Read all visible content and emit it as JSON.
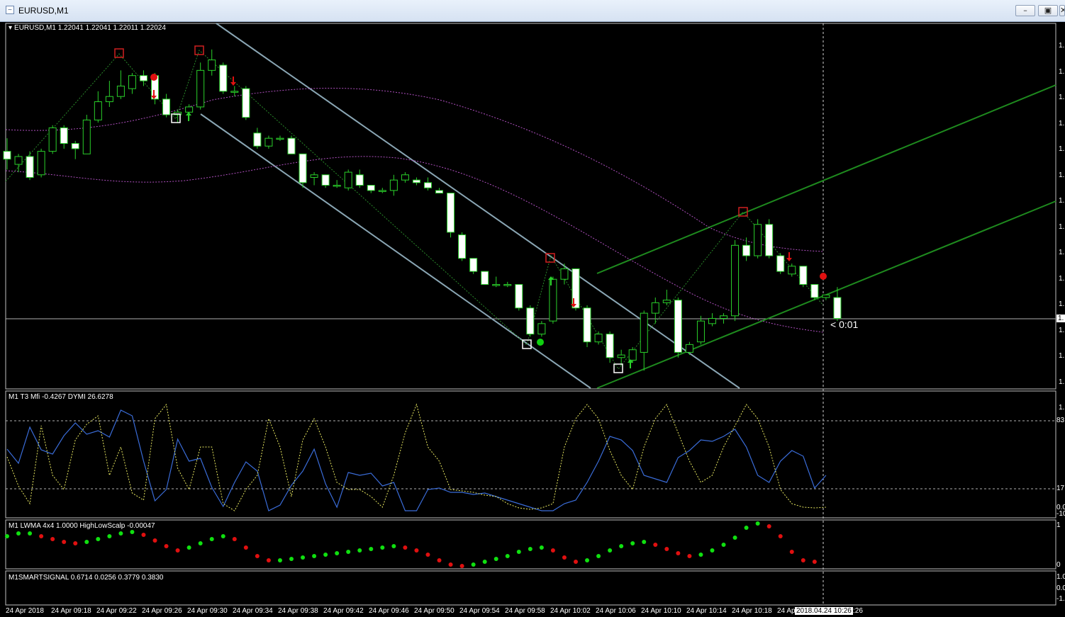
{
  "window": {
    "title": "EURUSD,M1",
    "minimize_icon": "minimize-icon",
    "restore_icon": "restore-icon",
    "close_icon": "close-icon"
  },
  "main_panel": {
    "header": "EURUSD,M1  1.22041 1.22041 1.22011 1.22024",
    "timer_label": "< 0:01",
    "price_axis_ticks": [
      "1.",
      "1.",
      "1.",
      "1.",
      "1.",
      "1.",
      "1.",
      "1.",
      "1.",
      "1.",
      "1.",
      "1.",
      "1.",
      "1.",
      "1."
    ],
    "current_price_label": "1."
  },
  "indicator1": {
    "header": "M1  T3 Mfi  -0.4267  DYMI 26.6278",
    "axis_labels": [
      "83",
      "17",
      "0.0",
      "-10"
    ]
  },
  "indicator2": {
    "header": "M1 LWMA 4x4  1.0000  HighLowScalp -0.00047",
    "axis_labels": [
      "1",
      "0"
    ]
  },
  "indicator3": {
    "header": "M1SMARTSIGNAL 0.6714 0.0256 0.3779 0.3830",
    "axis_labels": [
      "1.0",
      "0.0",
      "-1."
    ]
  },
  "time_axis": {
    "labels": [
      "24 Apr 2018",
      "24 Apr 09:18",
      "24 Apr 09:22",
      "24 Apr 09:26",
      "24 Apr 09:30",
      "24 Apr 09:34",
      "24 Apr 09:38",
      "24 Apr 09:42",
      "24 Apr 09:46",
      "24 Apr 09:50",
      "24 Apr 09:54",
      "24 Apr 09:58",
      "24 Apr 10:02",
      "24 Apr 10:06",
      "24 Apr 10:10",
      "24 Apr 10:14",
      "24 Apr 10:18",
      "24 Ap"
    ],
    "cursor_label": "2018.04.24 10:26",
    "cursor_tail": ":26"
  },
  "chart_data": {
    "type": "candlestick",
    "symbol": "EURUSD",
    "timeframe": "M1",
    "last_bar": {
      "open": 1.22041,
      "high": 1.22041,
      "low": 1.22011,
      "close": 1.22024
    },
    "candles": [
      {
        "o": 1.2231,
        "h": 1.2236,
        "l": 1.2224,
        "c": 1.2228
      },
      {
        "o": 1.2226,
        "h": 1.223,
        "l": 1.2223,
        "c": 1.2229
      },
      {
        "o": 1.2229,
        "h": 1.2231,
        "l": 1.222,
        "c": 1.2221
      },
      {
        "o": 1.2222,
        "h": 1.2232,
        "l": 1.2221,
        "c": 1.2231
      },
      {
        "o": 1.2231,
        "h": 1.2241,
        "l": 1.223,
        "c": 1.224
      },
      {
        "o": 1.224,
        "h": 1.2241,
        "l": 1.2232,
        "c": 1.2234
      },
      {
        "o": 1.2234,
        "h": 1.2235,
        "l": 1.2228,
        "c": 1.2232
      },
      {
        "o": 1.223,
        "h": 1.2245,
        "l": 1.223,
        "c": 1.2243
      },
      {
        "o": 1.2243,
        "h": 1.2254,
        "l": 1.2242,
        "c": 1.225
      },
      {
        "o": 1.225,
        "h": 1.2258,
        "l": 1.2248,
        "c": 1.2252
      },
      {
        "o": 1.2252,
        "h": 1.2262,
        "l": 1.2251,
        "c": 1.2256
      },
      {
        "o": 1.2255,
        "h": 1.2261,
        "l": 1.2253,
        "c": 1.226
      },
      {
        "o": 1.226,
        "h": 1.2262,
        "l": 1.2256,
        "c": 1.2258
      },
      {
        "o": 1.226,
        "h": 1.2261,
        "l": 1.2249,
        "c": 1.2251
      },
      {
        "o": 1.2251,
        "h": 1.2253,
        "l": 1.2244,
        "c": 1.2245
      },
      {
        "o": 1.2245,
        "h": 1.2247,
        "l": 1.2242,
        "c": 1.2246
      },
      {
        "o": 1.2246,
        "h": 1.2249,
        "l": 1.2243,
        "c": 1.2248
      },
      {
        "o": 1.2248,
        "h": 1.2265,
        "l": 1.2247,
        "c": 1.2262
      },
      {
        "o": 1.2262,
        "h": 1.227,
        "l": 1.226,
        "c": 1.2266
      },
      {
        "o": 1.2264,
        "h": 1.2265,
        "l": 1.2253,
        "c": 1.2254
      },
      {
        "o": 1.2254,
        "h": 1.2256,
        "l": 1.2252,
        "c": 1.2254
      },
      {
        "o": 1.2255,
        "h": 1.2256,
        "l": 1.2243,
        "c": 1.2244
      },
      {
        "o": 1.2238,
        "h": 1.224,
        "l": 1.2232,
        "c": 1.2233
      },
      {
        "o": 1.2233,
        "h": 1.2237,
        "l": 1.2232,
        "c": 1.2236
      },
      {
        "o": 1.2236,
        "h": 1.2237,
        "l": 1.2235,
        "c": 1.2236
      },
      {
        "o": 1.2236,
        "h": 1.2237,
        "l": 1.223,
        "c": 1.223
      },
      {
        "o": 1.223,
        "h": 1.223,
        "l": 1.2217,
        "c": 1.2219
      },
      {
        "o": 1.2221,
        "h": 1.2223,
        "l": 1.2218,
        "c": 1.2222
      },
      {
        "o": 1.2222,
        "h": 1.2222,
        "l": 1.2217,
        "c": 1.2218
      },
      {
        "o": 1.2218,
        "h": 1.222,
        "l": 1.2217,
        "c": 1.2218
      },
      {
        "o": 1.2217,
        "h": 1.2224,
        "l": 1.2216,
        "c": 1.2223
      },
      {
        "o": 1.2222,
        "h": 1.2224,
        "l": 1.2217,
        "c": 1.2218
      },
      {
        "o": 1.2218,
        "h": 1.2218,
        "l": 1.2215,
        "c": 1.2216
      },
      {
        "o": 1.2216,
        "h": 1.2217,
        "l": 1.2215,
        "c": 1.2216
      },
      {
        "o": 1.2216,
        "h": 1.2222,
        "l": 1.2214,
        "c": 1.222
      },
      {
        "o": 1.222,
        "h": 1.2223,
        "l": 1.2219,
        "c": 1.2222
      },
      {
        "o": 1.222,
        "h": 1.2221,
        "l": 1.2218,
        "c": 1.2219
      },
      {
        "o": 1.2219,
        "h": 1.2221,
        "l": 1.2216,
        "c": 1.2217
      },
      {
        "o": 1.2216,
        "h": 1.2217,
        "l": 1.2215,
        "c": 1.2215
      },
      {
        "o": 1.2215,
        "h": 1.2215,
        "l": 1.2198,
        "c": 1.22
      },
      {
        "o": 1.2199,
        "h": 1.22,
        "l": 1.2189,
        "c": 1.219
      },
      {
        "o": 1.219,
        "h": 1.219,
        "l": 1.2184,
        "c": 1.2185
      },
      {
        "o": 1.2185,
        "h": 1.2185,
        "l": 1.218,
        "c": 1.218
      },
      {
        "o": 1.218,
        "h": 1.2183,
        "l": 1.2179,
        "c": 1.218
      },
      {
        "o": 1.218,
        "h": 1.2181,
        "l": 1.2179,
        "c": 1.218
      },
      {
        "o": 1.218,
        "h": 1.218,
        "l": 1.217,
        "c": 1.2171
      },
      {
        "o": 1.2171,
        "h": 1.2172,
        "l": 1.216,
        "c": 1.2161
      },
      {
        "o": 1.2161,
        "h": 1.2166,
        "l": 1.216,
        "c": 1.2165
      },
      {
        "o": 1.2166,
        "h": 1.2183,
        "l": 1.2165,
        "c": 1.2182
      },
      {
        "o": 1.2182,
        "h": 1.2188,
        "l": 1.218,
        "c": 1.2186
      },
      {
        "o": 1.2186,
        "h": 1.2186,
        "l": 1.217,
        "c": 1.2171
      },
      {
        "o": 1.2171,
        "h": 1.2172,
        "l": 1.2156,
        "c": 1.2158
      },
      {
        "o": 1.2158,
        "h": 1.2162,
        "l": 1.2157,
        "c": 1.2161
      },
      {
        "o": 1.2161,
        "h": 1.2162,
        "l": 1.215,
        "c": 1.2152
      },
      {
        "o": 1.2152,
        "h": 1.2155,
        "l": 1.2149,
        "c": 1.2153
      },
      {
        "o": 1.2151,
        "h": 1.2156,
        "l": 1.215,
        "c": 1.2155
      },
      {
        "o": 1.2154,
        "h": 1.217,
        "l": 1.2147,
        "c": 1.2169
      },
      {
        "o": 1.2169,
        "h": 1.2175,
        "l": 1.2165,
        "c": 1.2173
      },
      {
        "o": 1.2173,
        "h": 1.2178,
        "l": 1.2172,
        "c": 1.2174
      },
      {
        "o": 1.2174,
        "h": 1.2175,
        "l": 1.2152,
        "c": 1.2154
      },
      {
        "o": 1.2154,
        "h": 1.2158,
        "l": 1.2153,
        "c": 1.2157
      },
      {
        "o": 1.2158,
        "h": 1.2168,
        "l": 1.2157,
        "c": 1.2166
      },
      {
        "o": 1.2165,
        "h": 1.2169,
        "l": 1.2164,
        "c": 1.2167
      },
      {
        "o": 1.2167,
        "h": 1.2169,
        "l": 1.2165,
        "c": 1.2168
      },
      {
        "o": 1.2168,
        "h": 1.2197,
        "l": 1.2166,
        "c": 1.2195
      },
      {
        "o": 1.2195,
        "h": 1.2198,
        "l": 1.2189,
        "c": 1.2191
      },
      {
        "o": 1.2191,
        "h": 1.2205,
        "l": 1.219,
        "c": 1.2203
      },
      {
        "o": 1.2203,
        "h": 1.2205,
        "l": 1.219,
        "c": 1.2191
      },
      {
        "o": 1.2191,
        "h": 1.2192,
        "l": 1.2184,
        "c": 1.2185
      },
      {
        "o": 1.2184,
        "h": 1.2188,
        "l": 1.2183,
        "c": 1.2187
      },
      {
        "o": 1.2187,
        "h": 1.2187,
        "l": 1.2179,
        "c": 1.218
      },
      {
        "o": 1.218,
        "h": 1.218,
        "l": 1.2174,
        "c": 1.2175
      },
      {
        "o": 1.2175,
        "h": 1.2175,
        "l": 1.2174,
        "c": 1.2176
      },
      {
        "o": 1.2175,
        "h": 1.2179,
        "l": 1.2166,
        "c": 1.2167
      }
    ],
    "price_range": [
      1.214,
      1.228
    ],
    "grid": false
  }
}
